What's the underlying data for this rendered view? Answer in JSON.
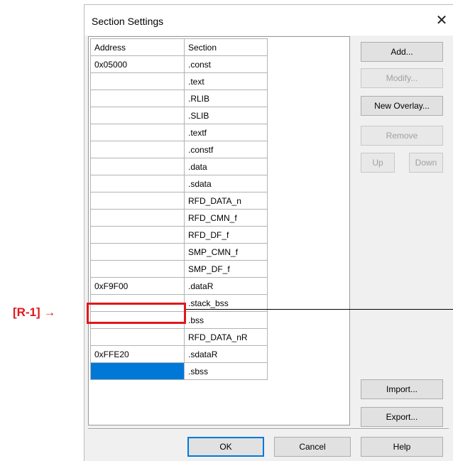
{
  "annotation": {
    "label": "[R-1] →"
  },
  "dialog": {
    "title": "Section Settings",
    "close_glyph": "✕",
    "columns": [
      "Address",
      "Section"
    ],
    "rows": [
      {
        "address": "0x05000",
        "section": ".const"
      },
      {
        "address": "",
        "section": ".text"
      },
      {
        "address": "",
        "section": ".RLIB"
      },
      {
        "address": "",
        "section": ".SLIB"
      },
      {
        "address": "",
        "section": ".textf"
      },
      {
        "address": "",
        "section": ".constf"
      },
      {
        "address": "",
        "section": ".data"
      },
      {
        "address": "",
        "section": ".sdata"
      },
      {
        "address": "",
        "section": "RFD_DATA_n"
      },
      {
        "address": "",
        "section": "RFD_CMN_f"
      },
      {
        "address": "",
        "section": "RFD_DF_f"
      },
      {
        "address": "",
        "section": "SMP_CMN_f"
      },
      {
        "address": "",
        "section": "SMP_DF_f"
      },
      {
        "address": "0xF9F00",
        "section": ".dataR"
      },
      {
        "address": "",
        "section": ".stack_bss"
      },
      {
        "address": "",
        "section": ".bss"
      },
      {
        "address": "",
        "section": "RFD_DATA_nR"
      },
      {
        "address": "0xFFE20",
        "section": ".sdataR"
      },
      {
        "address": "",
        "section": ".sbss"
      }
    ],
    "buttons": {
      "add": "Add...",
      "modify": "Modify...",
      "new_overlay": "New Overlay...",
      "remove": "Remove",
      "up": "Up",
      "down": "Down",
      "import": "Import...",
      "export": "Export...",
      "ok": "OK",
      "cancel": "Cancel",
      "help": "Help"
    }
  }
}
